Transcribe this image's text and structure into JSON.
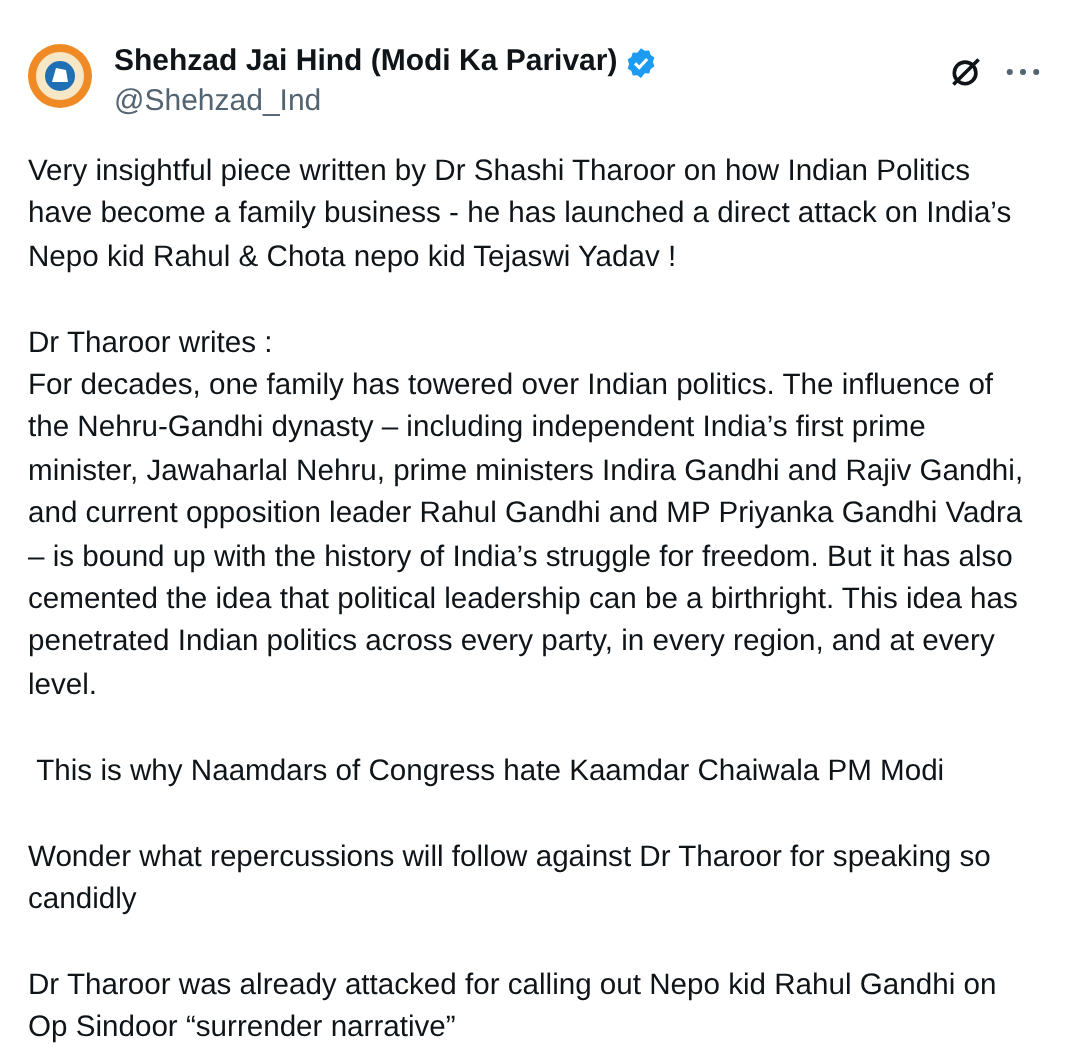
{
  "author": {
    "name": "Shehzad Jai Hind (Modi Ka Parivar)",
    "handle": "@Shehzad_Ind",
    "verified": true
  },
  "text": "Very insightful piece written by Dr Shashi Tharoor on how Indian Politics have become a family business - he has launched a direct attack on India’s Nepo kid Rahul & Chota nepo kid Tejaswi Yadav !\n\nDr Tharoor writes :\nFor decades, one family has towered over Indian politics. The influence of the Nehru-Gandhi dynasty – including independent India’s first prime minister, Jawaharlal Nehru, prime ministers Indira Gandhi and Rajiv Gandhi, and current opposition leader Rahul Gandhi and MP Priyanka Gandhi Vadra – is bound up with the history of India’s struggle for freedom. But it has also cemented the idea that political leadership can be a birthright. This idea has penetrated Indian politics across every party, in every region, and at every level.\n\n This is why Naamdars of Congress hate Kaamdar Chaiwala PM Modi\n\nWonder what repercussions will follow against Dr Tharoor for speaking so candidly\n\nDr Tharoor was already attacked for calling out Nepo kid Rahul Gandhi on Op Sindoor “surrender narrative”"
}
